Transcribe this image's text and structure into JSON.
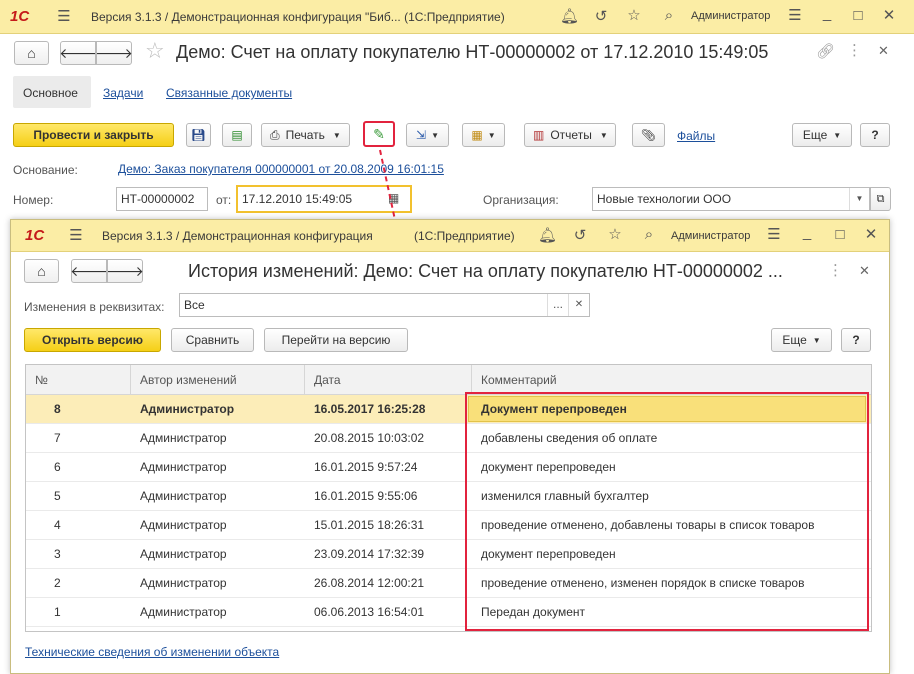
{
  "outer": {
    "logo": "1С",
    "title": "Версия 3.1.3 / Демонстрационная конфигурация \"Биб...  (1С:Предприятие)",
    "user": "Администратор",
    "doc_title": "Демо: Счет на оплату покупателю НТ-00000002 от 17.12.2010 15:49:05",
    "tabs": {
      "main": "Основное",
      "tasks": "Задачи",
      "related": "Связанные документы"
    },
    "toolbar": {
      "post_close": "Провести и закрыть",
      "print": "Печать",
      "reports": "Отчеты",
      "files": "Файлы",
      "more": "Еще",
      "help": "?"
    },
    "basis_label": "Основание:",
    "basis_value": "Демо: Заказ покупателя 000000001 от 20.08.2009 16:01:15",
    "number_label": "Номер:",
    "number_value": "НТ-00000002",
    "date_label": "от:",
    "date_value": "17.12.2010 15:49:05",
    "org_label": "Организация:",
    "org_value": "Новые технологии ООО"
  },
  "inner": {
    "logo": "1С",
    "title": "Версия 3.1.3 / Демонстрационная конфигурация",
    "title_suffix": "(1С:Предприятие)",
    "user": "Администратор",
    "form_title": "История изменений: Демо: Счет на оплату покупателю НТ-00000002 ...",
    "filter_label": "Изменения в реквизитах:",
    "filter_value": "Все",
    "buttons": {
      "open_version": "Открыть версию",
      "compare": "Сравнить",
      "goto_version": "Перейти на версию",
      "more": "Еще",
      "help": "?"
    },
    "columns": {
      "num": "№",
      "author": "Автор изменений",
      "date": "Дата",
      "comment": "Комментарий"
    },
    "rows": [
      {
        "num": "8",
        "author": "Администратор",
        "date": "16.05.2017 16:25:28",
        "comment": "Документ перепроведен"
      },
      {
        "num": "7",
        "author": "Администратор",
        "date": "20.08.2015 10:03:02",
        "comment": "добавлены сведения об оплате"
      },
      {
        "num": "6",
        "author": "Администратор",
        "date": "16.01.2015 9:57:24",
        "comment": "документ перепроведен"
      },
      {
        "num": "5",
        "author": "Администратор",
        "date": "16.01.2015 9:55:06",
        "comment": "изменился главный бухгалтер"
      },
      {
        "num": "4",
        "author": "Администратор",
        "date": "15.01.2015 18:26:31",
        "comment": "проведение отменено, добавлены товары в список товаров"
      },
      {
        "num": "3",
        "author": "Администратор",
        "date": "23.09.2014 17:32:39",
        "comment": "документ перепроведен"
      },
      {
        "num": "2",
        "author": "Администратор",
        "date": "26.08.2014 12:00:21",
        "comment": "проведение отменено, изменен порядок в списке товаров"
      },
      {
        "num": "1",
        "author": "Администратор",
        "date": "06.06.2013 16:54:01",
        "comment": "Передан документ"
      }
    ],
    "tech_link": "Технические сведения об изменении объекта"
  },
  "colors": {
    "titlebar": "#fbeda5",
    "accent_yellow": "#f5cf16",
    "link": "#1c4f9b",
    "highlight_red": "#e2233e",
    "selected_row": "#fcedb8"
  }
}
